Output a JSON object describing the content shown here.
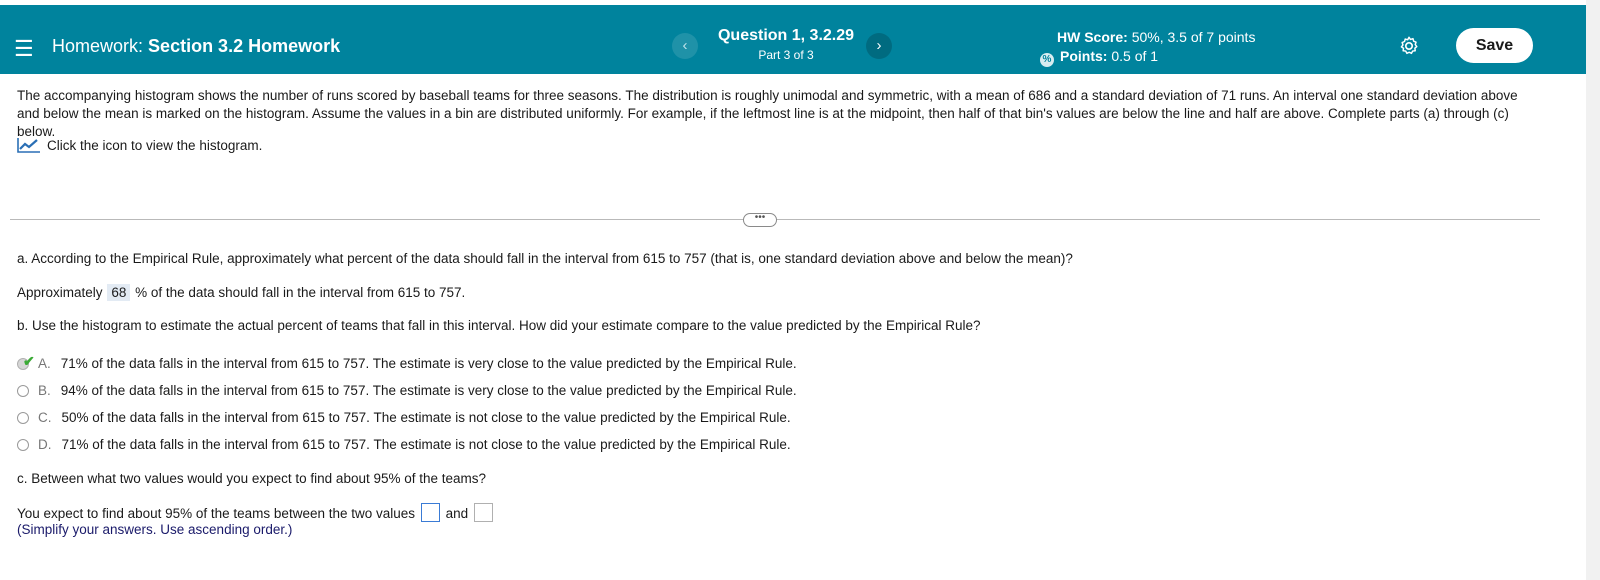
{
  "header": {
    "title_prefix": "Homework:",
    "title": "Section 3.2 Homework",
    "question_title": "Question 1, 3.2.29",
    "question_part": "Part 3 of 3",
    "score_label": "HW Score:",
    "score_value": "50%, 3.5 of 7 points",
    "points_label": "Points:",
    "points_value": "0.5 of 1",
    "save_label": "Save",
    "prev_icon": "‹",
    "next_icon": "›"
  },
  "problem": {
    "intro": "The accompanying histogram shows the number of runs scored by baseball teams for three seasons. The distribution is roughly unimodal and symmetric, with a mean of 686 and a standard deviation of 71 runs. An interval one standard deviation above and below the mean is marked on the histogram. Assume the values in a bin are distributed uniformly. For example, if the leftmost line is at the midpoint, then half of that bin's values are below the line and half are above. Complete parts (a) through (c) below.",
    "histogram_link": "Click the icon to view the histogram."
  },
  "part_a": {
    "question": "a. According to the Empirical Rule, approximately what percent of the data should fall in the interval from 615 to 757 (that is, one standard deviation above and below the mean)?",
    "answer_prefix": "Approximately",
    "answer_value": "68",
    "answer_suffix": "% of the data should fall in the interval from 615 to 757."
  },
  "part_b": {
    "question": "b. Use the histogram to estimate the actual percent of teams that fall in this interval. How did your estimate compare to the value predicted by the Empirical Rule?",
    "options": [
      {
        "letter": "A.",
        "text": "71% of the data falls in the interval from 615 to 757. The estimate is very close to the value predicted by the Empirical Rule.",
        "selected": true
      },
      {
        "letter": "B.",
        "text": "94% of the data falls in the interval from 615 to 757. The estimate is very close to the value predicted by the Empirical Rule.",
        "selected": false
      },
      {
        "letter": "C.",
        "text": "50% of the data falls in the interval from 615 to 757. The estimate is not close to the value predicted by the Empirical Rule.",
        "selected": false
      },
      {
        "letter": "D.",
        "text": "71% of the data falls in the interval from 615 to 757. The estimate is not close to the value predicted by the Empirical Rule.",
        "selected": false
      }
    ]
  },
  "part_c": {
    "question": "c. Between what two values would you expect to find about 95% of the teams?",
    "answer_prefix": "You expect to find about 95% of the teams between the two values",
    "answer_and": "and",
    "hint": "(Simplify your answers. Use ascending order.)"
  },
  "colors": {
    "header_bg": "#00839d",
    "check_green": "#3aaa35",
    "answer_highlight": "#e3ebf4"
  }
}
